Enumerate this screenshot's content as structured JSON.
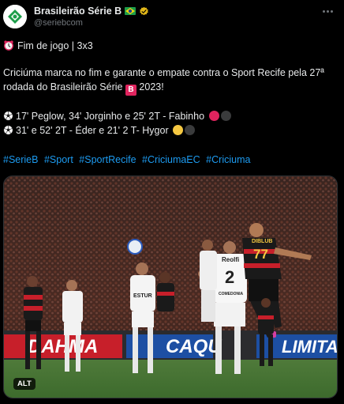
{
  "account": {
    "name": "Brasileirão Série B",
    "handle": "@seriebcom",
    "flag_icon": "brazil-flag-icon",
    "verified_icon": "verified-gold-icon"
  },
  "tweet": {
    "status_line": "Fim de jogo | 3x3",
    "status_icon": "alarm-clock-icon",
    "body_line1": "Criciúma marca no fim e garante o empate contra o Sport Recife pela 27ª",
    "body_line2_prefix": "rodada do Brasileirão Série ",
    "body_line2_badge": "B",
    "body_line2_suffix": " 2023!",
    "goals_sport": "17' Peglow, 34' Jorginho e 25' 2T - Fabinho",
    "goals_criciuma": "31' e 52' 2T - Éder e 21' 2 T- Hygor",
    "sport_colors": [
      "#e0245e",
      "#3a3b3c"
    ],
    "criciuma_colors": [
      "#f5c842",
      "#3a3b3c"
    ],
    "hashtags": [
      "#SerieB",
      "#Sport",
      "#SportRecife",
      "#CriciumaEC",
      "#Criciuma"
    ]
  },
  "media": {
    "alt_label": "ALT",
    "banner_left": "DAHMA",
    "banner_mid": "CAQU",
    "banner_right": "LIMITA",
    "jersey_red_name": "DIBLUB",
    "jersey_red_number": "77",
    "jersey_white_number": "2",
    "jersey_white_sponsor": "Reolfi",
    "jersey_white_name": "COMEDONIA",
    "jersey_white2_sponsor": "ESTUR"
  },
  "colors": {
    "background": "#000000",
    "text": "#e7e9ea",
    "secondary": "#71767b",
    "link": "#1d9bf0"
  }
}
